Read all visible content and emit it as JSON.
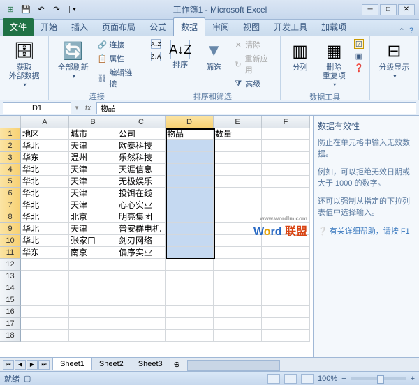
{
  "title": "工作簿1 - Microsoft Excel",
  "tabs": {
    "file": "文件",
    "home": "开始",
    "insert": "插入",
    "layout": "页面布局",
    "formula": "公式",
    "data": "数据",
    "review": "审阅",
    "view": "视图",
    "dev": "开发工具",
    "addin": "加载项"
  },
  "ribbon": {
    "g1": {
      "b1": "获取\n外部数据"
    },
    "g2": {
      "b1": "全部刷新",
      "s1": "连接",
      "s2": "属性",
      "s3": "编辑链接",
      "label": "连接"
    },
    "g3": {
      "b1": "排序",
      "b2": "筛选",
      "s1": "清除",
      "s2": "重新应用",
      "s3": "高级",
      "label": "排序和筛选"
    },
    "g4": {
      "b1": "分列",
      "b2": "删除\n重复项",
      "label": "数据工具"
    },
    "g5": {
      "b1": "分级显示"
    }
  },
  "namebox": "D1",
  "formula": "物品",
  "cols": [
    "A",
    "B",
    "C",
    "D",
    "E",
    "F"
  ],
  "data": [
    [
      "地区",
      "城市",
      "公司",
      "物品",
      "数量",
      ""
    ],
    [
      "华北",
      "天津",
      "欧泰科技",
      "",
      "",
      ""
    ],
    [
      "华东",
      "温州",
      "乐然科技",
      "",
      "",
      ""
    ],
    [
      "华北",
      "天津",
      "天涯信息",
      "",
      "",
      ""
    ],
    [
      "华北",
      "天津",
      "无极娱乐",
      "",
      "",
      ""
    ],
    [
      "华北",
      "天津",
      "投饵在线",
      "",
      "",
      ""
    ],
    [
      "华北",
      "天津",
      "心心实业",
      "",
      "",
      ""
    ],
    [
      "华北",
      "北京",
      "明亮集团",
      "",
      "",
      ""
    ],
    [
      "华北",
      "天津",
      "普安群电机",
      "",
      "",
      ""
    ],
    [
      "华北",
      "张家口",
      "剑刃网络",
      "",
      "",
      ""
    ],
    [
      "华东",
      "南京",
      "偏序实业",
      "",
      "",
      ""
    ],
    [
      "",
      "",
      "",
      "",
      "",
      ""
    ],
    [
      "",
      "",
      "",
      "",
      "",
      ""
    ],
    [
      "",
      "",
      "",
      "",
      "",
      ""
    ],
    [
      "",
      "",
      "",
      "",
      "",
      ""
    ],
    [
      "",
      "",
      "",
      "",
      "",
      ""
    ],
    [
      "",
      "",
      "",
      "",
      "",
      ""
    ],
    [
      "",
      "",
      "",
      "",
      "",
      ""
    ]
  ],
  "help": {
    "title": "数据有效性",
    "p1": "防止在单元格中输入无效数据。",
    "p2": "例如，可以拒绝无效日期或大于 1000 的数字。",
    "p3": "还可以强制从指定的下拉列表值中选择输入。",
    "link": "有关详细帮助，请按 F1"
  },
  "sheets": [
    "Sheet1",
    "Sheet2",
    "Sheet3"
  ],
  "status": {
    "ready": "就绪",
    "zoom": "100%",
    "minus": "−",
    "plus": "+"
  },
  "wm": {
    "url": "www.wordlm.com",
    "t": "联盟"
  }
}
